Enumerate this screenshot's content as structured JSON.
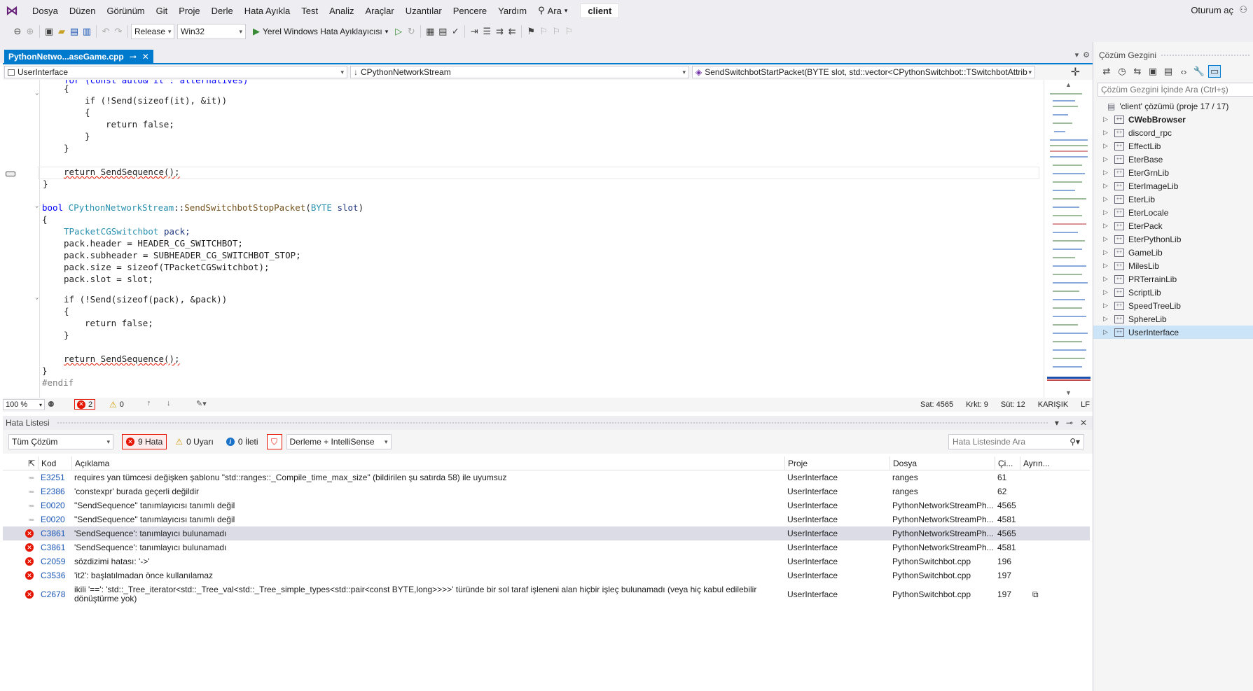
{
  "menubar": {
    "items": [
      "Dosya",
      "Düzen",
      "Görünüm",
      "Git",
      "Proje",
      "Derle",
      "Hata Ayıkla",
      "Test",
      "Analiz",
      "Araçlar",
      "Uzantılar",
      "Pencere",
      "Yardım"
    ],
    "search_label": "Ara",
    "solution_name": "client",
    "sign_in": "Oturum aç"
  },
  "toolbar": {
    "config": "Release",
    "platform": "Win32",
    "run_label": "Yerel Windows Hata Ayıklayıcısı"
  },
  "document_tab": {
    "title": "PythonNetwo...aseGame.cpp"
  },
  "navbar": {
    "project": "UserInterface",
    "scope": "CPythonNetworkStream",
    "member": "SendSwitchbotStartPacket(BYTE slot, std::vector<CPythonSwitchbot::TSwitchbotAttrib"
  },
  "editor_status": {
    "zoom": "100 %",
    "errors": "2",
    "warnings": "0",
    "line": "Sat: 4565",
    "char": "Krkt: 9",
    "col": "Süt: 12",
    "mixed": "KARIŞIK",
    "eol": "LF"
  },
  "error_list": {
    "title": "Hata Listesi",
    "scope": "Tüm Çözüm",
    "errors_btn": "9 Hata",
    "warnings_btn": "0 Uyarı",
    "messages_btn": "0 İleti",
    "source": "Derleme + IntelliSense",
    "search_placeholder": "Hata Listesinde Ara",
    "columns": [
      "Kod",
      "Açıklama",
      "Proje",
      "Dosya",
      "Çi...",
      "Ayrın..."
    ],
    "rows": [
      {
        "kind": "intellisense",
        "code": "E3251",
        "desc": "requires yan tümcesi değişken şablonu \"std::ranges::_Compile_time_max_size\" (bildirilen şu satırda 58) ile uyumsuz",
        "project": "UserInterface",
        "file": "ranges",
        "line": "61"
      },
      {
        "kind": "intellisense",
        "code": "E2386",
        "desc": "'constexpr' burada geçerli değildir",
        "project": "UserInterface",
        "file": "ranges",
        "line": "62"
      },
      {
        "kind": "intellisense",
        "code": "E0020",
        "desc": "\"SendSequence\" tanımlayıcısı tanımlı değil",
        "project": "UserInterface",
        "file": "PythonNetworkStreamPh...",
        "line": "4565"
      },
      {
        "kind": "intellisense",
        "code": "E0020",
        "desc": "\"SendSequence\" tanımlayıcısı tanımlı değil",
        "project": "UserInterface",
        "file": "PythonNetworkStreamPh...",
        "line": "4581"
      },
      {
        "kind": "error",
        "code": "C3861",
        "desc": "'SendSequence': tanımlayıcı bulunamadı",
        "project": "UserInterface",
        "file": "PythonNetworkStreamPh...",
        "line": "4565",
        "selected": true
      },
      {
        "kind": "error",
        "code": "C3861",
        "desc": "'SendSequence': tanımlayıcı bulunamadı",
        "project": "UserInterface",
        "file": "PythonNetworkStreamPh...",
        "line": "4581"
      },
      {
        "kind": "error",
        "code": "C2059",
        "desc": "sözdizimi hatası: '->'",
        "project": "UserInterface",
        "file": "PythonSwitchbot.cpp",
        "line": "196"
      },
      {
        "kind": "error",
        "code": "C3536",
        "desc": "'it2': başlatılmadan önce kullanılamaz",
        "project": "UserInterface",
        "file": "PythonSwitchbot.cpp",
        "line": "197"
      },
      {
        "kind": "error",
        "code": "C2678",
        "desc": "ikili '==': 'std::_Tree_iterator<std::_Tree_val<std::_Tree_simple_types<std::pair<const BYTE,long>>>>' türünde bir sol taraf işleneni alan hiçbir işleç bulunamadı (veya hiç kabul edilebilir dönüştürme yok)",
        "project": "UserInterface",
        "file": "PythonSwitchbot.cpp",
        "line": "197",
        "tall": true
      }
    ]
  },
  "solution_explorer": {
    "title": "Çözüm Gezgini",
    "search_placeholder": "Çözüm Gezgini İçinde Ara (Ctrl+ş)",
    "root": "'client' çözümü (proje 17 / 17)",
    "projects": [
      "CWebBrowser",
      "discord_rpc",
      "EffectLib",
      "EterBase",
      "EterGrnLib",
      "EterImageLib",
      "EterLib",
      "EterLocale",
      "EterPack",
      "EterPythonLib",
      "GameLib",
      "MilesLib",
      "PRTerrainLib",
      "ScriptLib",
      "SpeedTreeLib",
      "SphereLib",
      "UserInterface"
    ],
    "bold_project": "CWebBrowser",
    "selected_project": "UserInterface"
  },
  "code": {
    "line_top": "for (const auto& it : alternatives)",
    "brace_open1": "{",
    "if1": "if (!Send(sizeof(it), &it))",
    "brace_open2": "{",
    "return_false1": "return false;",
    "brace_close2": "}",
    "brace_close1": "}",
    "return_seq1": "return SendSequence();",
    "brace_close_fn1": "}",
    "fn_sig_kw": "bool",
    "fn_sig_class": "CPythonNetworkStream",
    "fn_sig_sep": "::",
    "fn_sig_name": "SendSwitchbotStopPacket",
    "fn_sig_ptype": "BYTE",
    "fn_sig_pname": "slot",
    "brace_open_fn2": "{",
    "decl_type": "TPacketCGSwitchbot",
    "decl_var": "pack;",
    "l_header": "pack.header = HEADER_CG_SWITCHBOT;",
    "l_subheader": "pack.subheader = SUBHEADER_CG_SWITCHBOT_STOP;",
    "l_size": "pack.size = sizeof(TPacketCGSwitchbot);",
    "l_slot": "pack.slot = slot;",
    "if2": "if (!Send(sizeof(pack), &pack))",
    "brace_open3": "{",
    "return_false2": "return false;",
    "brace_close3": "}",
    "return_seq2": "return SendSequence();",
    "brace_close_fn2": "}",
    "endif": "#endif"
  }
}
